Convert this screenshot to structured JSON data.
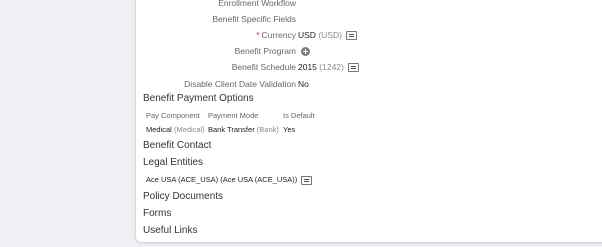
{
  "details": {
    "enrollment_workflow_label": "Enrollment Workflow",
    "benefit_specific_fields_label": "Benefit Specific Fields",
    "currency": {
      "required_mark": "*",
      "label": "Currency",
      "value": "USD",
      "code": "(USD)"
    },
    "benefit_program": {
      "label": "Benefit Program",
      "add_icon": "add-circle-icon"
    },
    "benefit_schedule": {
      "label": "Benefit Schedule",
      "value": "2015",
      "code": "(1242)"
    },
    "disable_client_date_validation": {
      "label": "Disable Client Date Validation",
      "value": "No"
    }
  },
  "payment_options": {
    "title": "Benefit Payment Options",
    "headers": [
      "Pay Component",
      "Payment Mode",
      "Is Default"
    ],
    "rows": [
      {
        "pay_component": "Medical",
        "pay_component_code": "(Medical)",
        "payment_mode": "Bank Transfer",
        "payment_mode_code": "(Bank)",
        "is_default": "Yes"
      }
    ]
  },
  "benefit_contact": {
    "title": "Benefit Contact"
  },
  "legal_entities": {
    "title": "Legal Entities",
    "entity": "Ace USA (ACE_USA) (Ace USA (ACE_USA))"
  },
  "policy_documents": {
    "title": "Policy Documents"
  },
  "forms": {
    "title": "Forms"
  },
  "useful_links": {
    "title": "Useful Links"
  }
}
